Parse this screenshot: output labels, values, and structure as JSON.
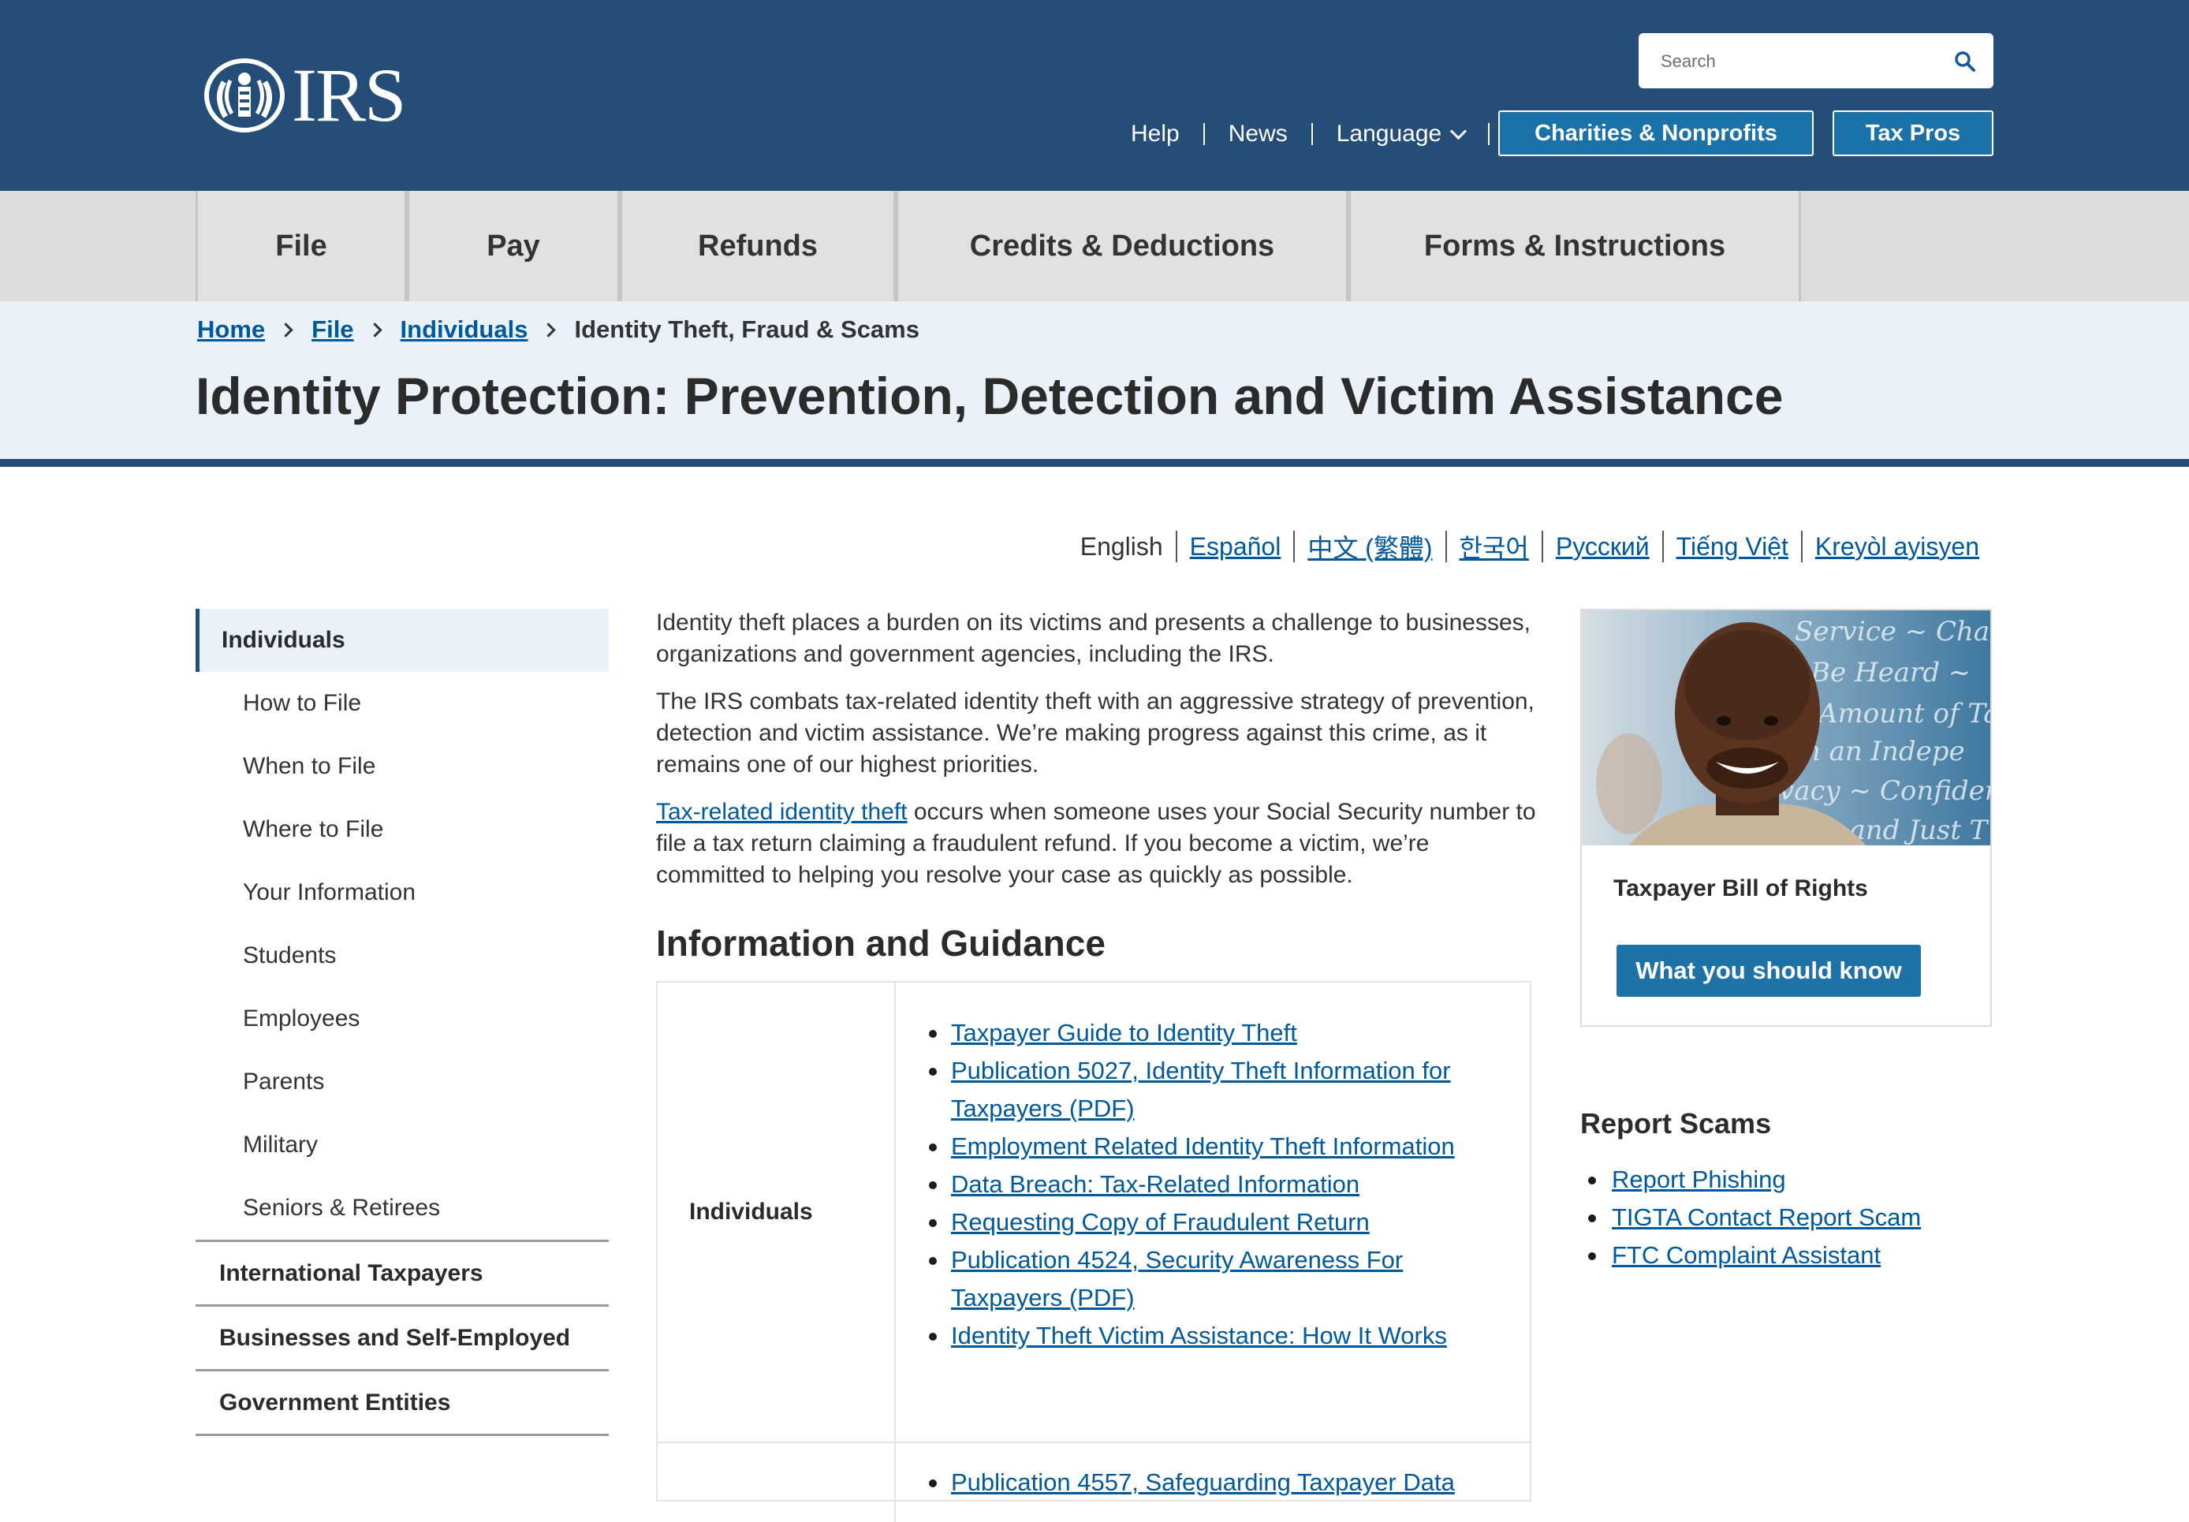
{
  "header": {
    "logo_text": "IRS",
    "search_placeholder": "Search",
    "utility_links": {
      "help": "Help",
      "news": "News",
      "language": "Language"
    },
    "buttons": {
      "charities": "Charities & Nonprofits",
      "tax_pros": "Tax Pros"
    }
  },
  "nav": {
    "items": [
      "File",
      "Pay",
      "Refunds",
      "Credits & Deductions",
      "Forms & Instructions"
    ]
  },
  "breadcrumb": {
    "items": [
      "Home",
      "File",
      "Individuals"
    ],
    "current": "Identity Theft, Fraud & Scams"
  },
  "page_title": "Identity Protection: Prevention, Detection and Victim Assistance",
  "languages": {
    "current": "English",
    "links": [
      "Español",
      "中文 (繁體)",
      "한국어",
      "Русский",
      "Tiếng Việt",
      "Kreyòl ayisyen"
    ]
  },
  "sidebar": {
    "active": "Individuals",
    "sub_items": [
      "How to File",
      "When to File",
      "Where to File",
      "Your Information",
      "Students",
      "Employees",
      "Parents",
      "Military",
      "Seniors & Retirees"
    ],
    "top_items": [
      "International Taxpayers",
      "Businesses and Self-Employed",
      "Government Entities"
    ]
  },
  "intro": {
    "p1": "Identity theft places a burden on its victims and presents a challenge to businesses, organizations and government agencies, including the IRS.",
    "p2": "The IRS combats tax-related identity theft with an aggressive strategy of prevention, detection and victim assistance. We’re making progress against this crime, as it remains one of our highest priorities.",
    "p3_link": "Tax-related identity theft",
    "p3_rest": " occurs when someone uses your Social Security number to file a tax return claiming a fraudulent refund. If you become a victim, we’re committed to helping you resolve your case as quickly as possible."
  },
  "guidance": {
    "heading": "Information and Guidance",
    "rows": [
      {
        "label": "Individuals",
        "links": [
          "Taxpayer Guide to Identity Theft",
          "Publication 5027, Identity Theft Information for Taxpayers (PDF)",
          "Employment Related Identity Theft Information",
          "Data Breach: Tax-Related Information",
          "Requesting Copy of Fraudulent Return",
          "Publication 4524, Security Awareness For Taxpayers (PDF)",
          "Identity Theft Victim Assistance: How It Works"
        ]
      },
      {
        "label": "",
        "links": [
          "Publication 4557, Safeguarding Taxpayer Data"
        ]
      }
    ]
  },
  "promo": {
    "title": "Taxpayer Bill of Rights",
    "button": "What you should know",
    "image_lines": [
      "Service ~ Cha",
      "Be Heard ~",
      "Amount of Ta",
      "in an Indepe",
      "vacy ~ Confiden",
      "Fair and Just T"
    ]
  },
  "report_scams": {
    "heading": "Report Scams",
    "links": [
      "Report Phishing",
      "TIGTA Contact Report Scam",
      "FTC Complaint Assistant"
    ]
  },
  "colors": {
    "header_bg": "#244e78",
    "link": "#00599c",
    "button": "#1f72a8",
    "banner_bg": "#eaf1f8",
    "nav_bg": "#e1e1e1"
  }
}
